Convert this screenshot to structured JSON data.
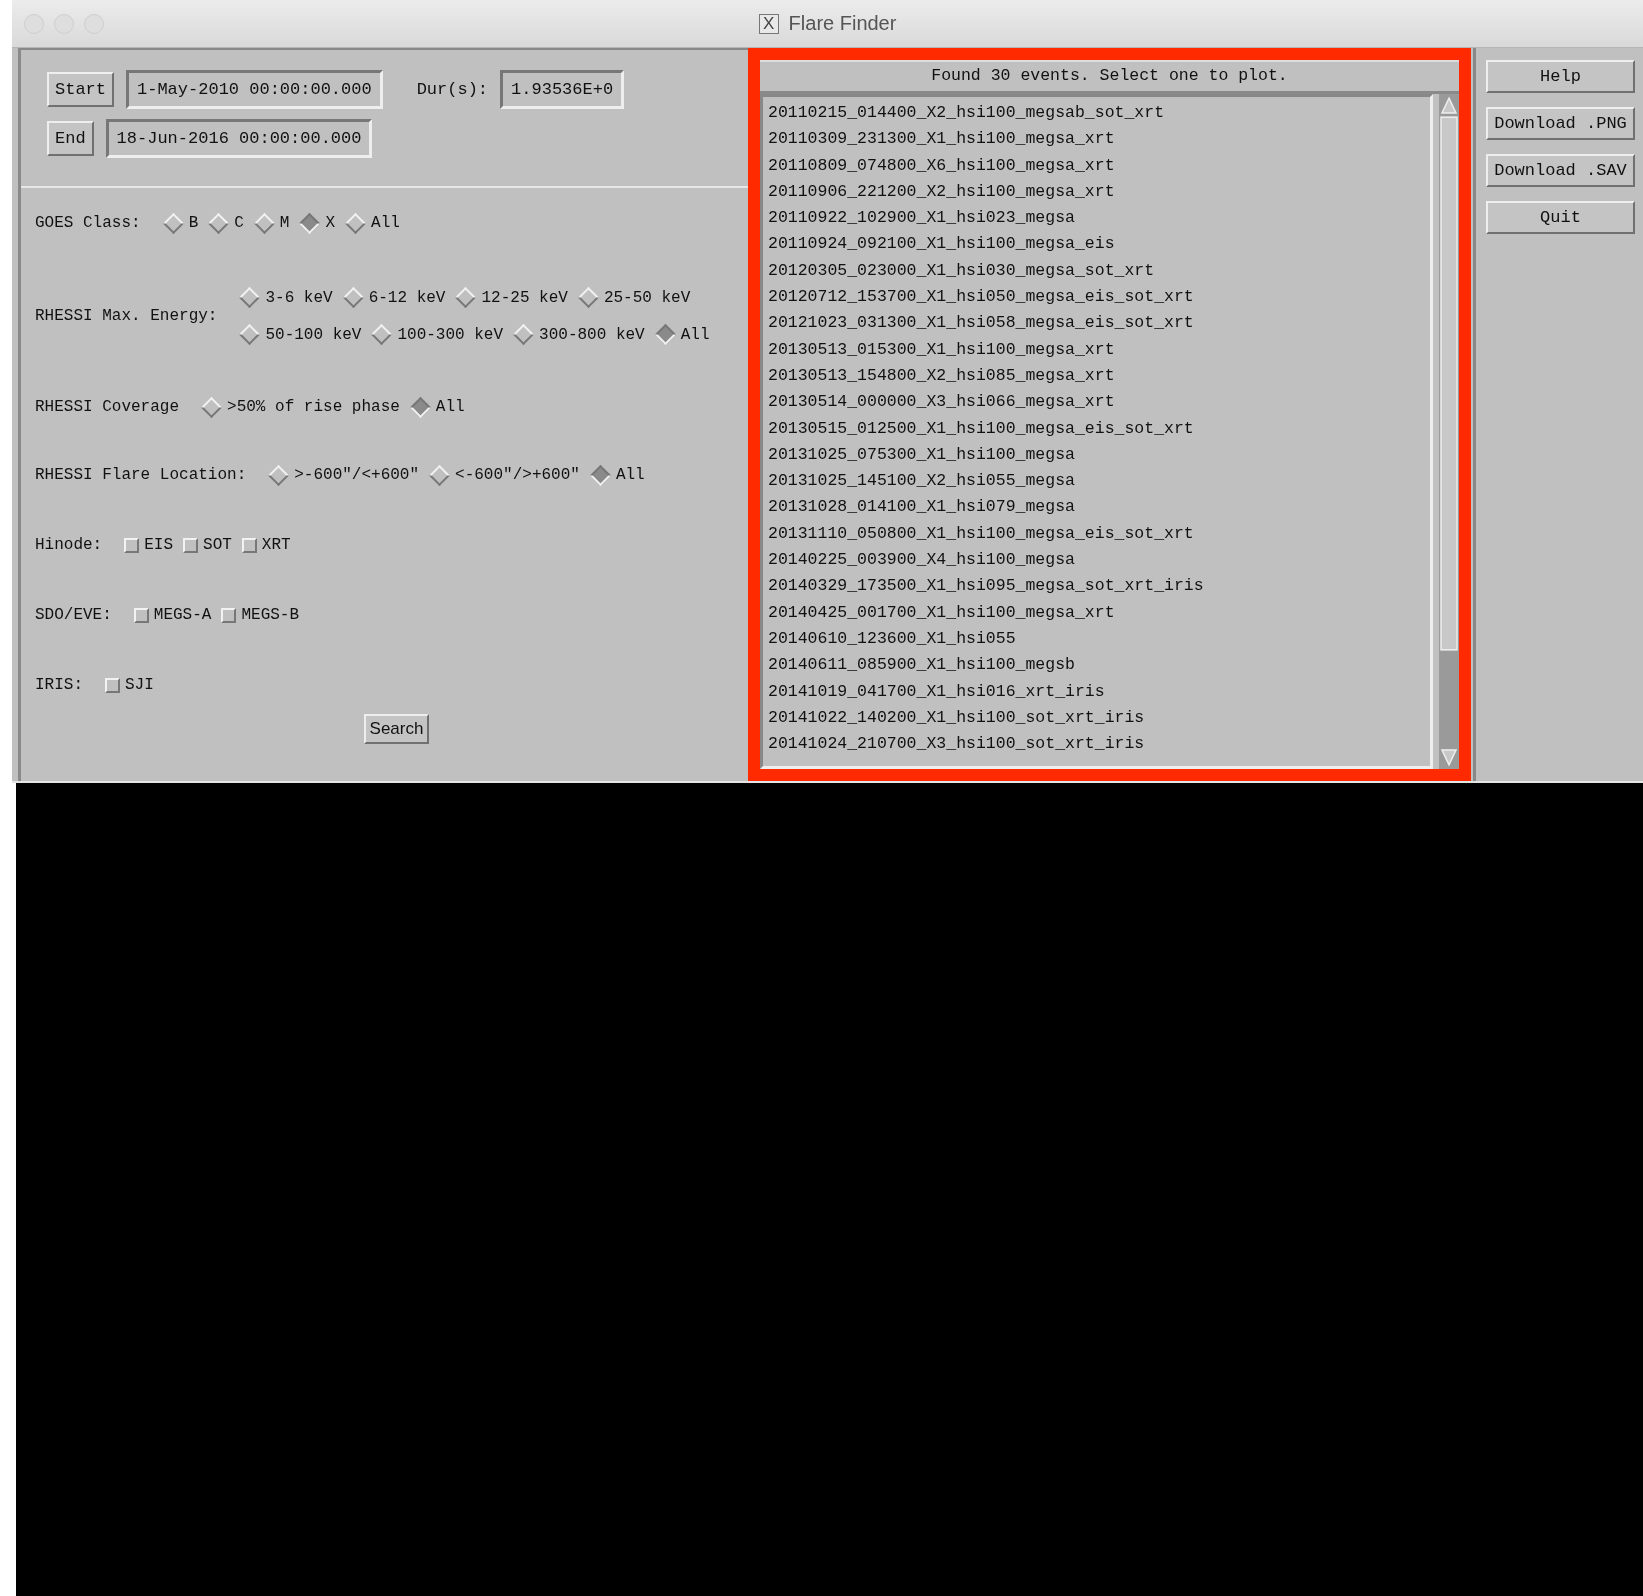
{
  "window": {
    "title": "Flare Finder",
    "title_icon": "X"
  },
  "time_range": {
    "start_button": "Start",
    "start_value": "1-May-2010 00:00:00.000",
    "end_button": "End",
    "end_value": "18-Jun-2016 00:00:00.000",
    "duration_label": "Dur(s):",
    "duration_value": "1.93536E+0"
  },
  "filters": [
    {
      "label": "GOES Class:",
      "kind": "radio",
      "option_rows": [
        [
          {
            "label": "B",
            "selected": false
          },
          {
            "label": "C",
            "selected": false
          },
          {
            "label": "M",
            "selected": false
          },
          {
            "label": "X",
            "selected": true
          },
          {
            "label": "All",
            "selected": false
          }
        ]
      ]
    },
    {
      "label": "RHESSI Max. Energy:",
      "kind": "radio",
      "option_rows": [
        [
          {
            "label": "3-6 keV",
            "selected": false
          },
          {
            "label": "6-12 keV",
            "selected": false
          },
          {
            "label": "12-25 keV",
            "selected": false
          },
          {
            "label": "25-50 keV",
            "selected": false
          }
        ],
        [
          {
            "label": "50-100 keV",
            "selected": false
          },
          {
            "label": "100-300 keV",
            "selected": false
          },
          {
            "label": "300-800 keV",
            "selected": false
          },
          {
            "label": "All",
            "selected": true
          }
        ]
      ]
    },
    {
      "label": "RHESSI Coverage",
      "kind": "radio",
      "option_rows": [
        [
          {
            "label": ">50% of rise phase",
            "selected": false
          },
          {
            "label": "All",
            "selected": true
          }
        ]
      ]
    },
    {
      "label": "RHESSI Flare Location:",
      "kind": "radio",
      "option_rows": [
        [
          {
            "label": ">-600\"/<+600\"",
            "selected": false
          },
          {
            "label": "<-600\"/>+600\"",
            "selected": false
          },
          {
            "label": "All",
            "selected": true
          }
        ]
      ]
    },
    {
      "label": "Hinode:",
      "kind": "checkbox",
      "option_rows": [
        [
          {
            "label": "EIS",
            "checked": false
          },
          {
            "label": "SOT",
            "checked": false
          },
          {
            "label": "XRT",
            "checked": false
          }
        ]
      ]
    },
    {
      "label": "SDO/EVE:",
      "kind": "checkbox",
      "option_rows": [
        [
          {
            "label": "MEGS-A",
            "checked": false
          },
          {
            "label": "MEGS-B",
            "checked": false
          }
        ]
      ]
    },
    {
      "label": "IRIS:",
      "kind": "checkbox",
      "option_rows": [
        [
          {
            "label": "SJI",
            "checked": false
          }
        ]
      ]
    }
  ],
  "search_button": "Search",
  "results": {
    "header": "Found 30 events. Select one to plot.",
    "items": [
      "20110215_014400_X2_hsi100_megsab_sot_xrt",
      "20110309_231300_X1_hsi100_megsa_xrt",
      "20110809_074800_X6_hsi100_megsa_xrt",
      "20110906_221200_X2_hsi100_megsa_xrt",
      "20110922_102900_X1_hsi023_megsa",
      "20110924_092100_X1_hsi100_megsa_eis",
      "20120305_023000_X1_hsi030_megsa_sot_xrt",
      "20120712_153700_X1_hsi050_megsa_eis_sot_xrt",
      "20121023_031300_X1_hsi058_megsa_eis_sot_xrt",
      "20130513_015300_X1_hsi100_megsa_xrt",
      "20130513_154800_X2_hsi085_megsa_xrt",
      "20130514_000000_X3_hsi066_megsa_xrt",
      "20130515_012500_X1_hsi100_megsa_eis_sot_xrt",
      "20131025_075300_X1_hsi100_megsa",
      "20131025_145100_X2_hsi055_megsa",
      "20131028_014100_X1_hsi079_megsa",
      "20131110_050800_X1_hsi100_megsa_eis_sot_xrt",
      "20140225_003900_X4_hsi100_megsa",
      "20140329_173500_X1_hsi095_megsa_sot_xrt_iris",
      "20140425_001700_X1_hsi100_megsa_xrt",
      "20140610_123600_X1_hsi055",
      "20140611_085900_X1_hsi100_megsb",
      "20141019_041700_X1_hsi016_xrt_iris",
      "20141022_140200_X1_hsi100_sot_xrt_iris",
      "20141024_210700_X3_hsi100_sot_xrt_iris"
    ]
  },
  "side_buttons": [
    "Help",
    "Download .PNG",
    "Download .SAV",
    "Quit"
  ]
}
